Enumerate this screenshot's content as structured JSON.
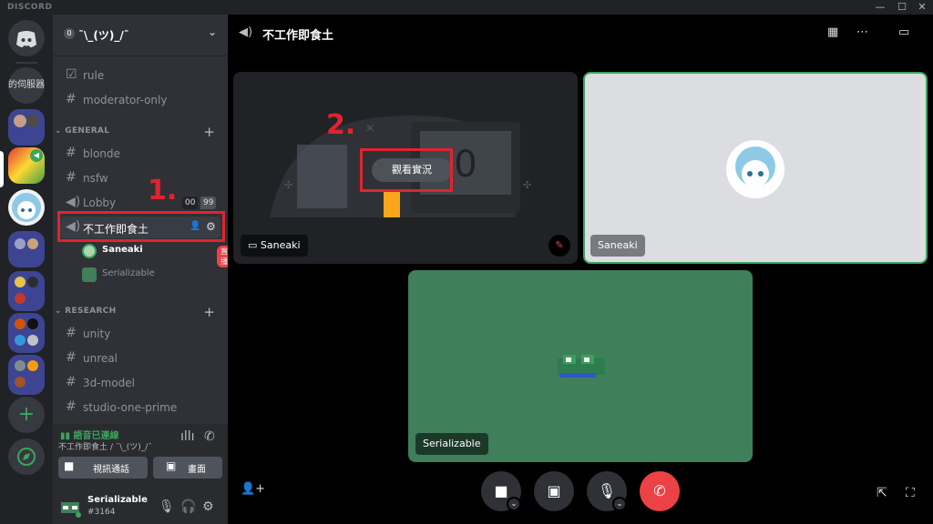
{
  "app": {
    "brand": "DISCORD"
  },
  "window": {
    "min": "—",
    "max": "☐",
    "close": "✕"
  },
  "rail": {
    "home_icon": "discord-logo-icon",
    "text_server": "的伺服器",
    "add": "+",
    "explore": "✦"
  },
  "guild": {
    "name": "¯\\_(ツ)_/¯",
    "boost": "0"
  },
  "channels": {
    "rule": "rule",
    "moderator": "moderator-only",
    "general_cat": "GENERAL",
    "blonde": "blonde",
    "nsfw": "nsfw",
    "lobby": "Lobby",
    "lobby_count_a": "00",
    "lobby_count_b": "99",
    "voice_active": "不工作即食土",
    "research_cat": "RESEARCH",
    "unity": "unity",
    "unreal": "unreal",
    "model3d": "3d-model",
    "studio": "studio-one-prime"
  },
  "voice_users": [
    {
      "name": "Saneaki",
      "badge": "直播"
    },
    {
      "name": "Serializable"
    }
  ],
  "annotations": {
    "step1": "1.",
    "step2": "2."
  },
  "voice_panel": {
    "status": "語音已連線",
    "subtitle": "不工作即食土 / ¯\\_(ツ)_/¯",
    "video_btn": "視訊通話",
    "screen_btn": "畫面"
  },
  "user": {
    "name": "Serializable",
    "tag": "#3164"
  },
  "stage": {
    "title": "不工作即食土",
    "watch_label": "觀看實況",
    "tiles": [
      {
        "name": "Saneaki"
      },
      {
        "name": "Saneaki"
      },
      {
        "name": "Serializable"
      }
    ],
    "colors": {
      "green_tile": "#3f7f5a",
      "gray_tile": "#dcdde1",
      "hangup": "#ed4245",
      "accent_red": "#e0242f"
    }
  }
}
